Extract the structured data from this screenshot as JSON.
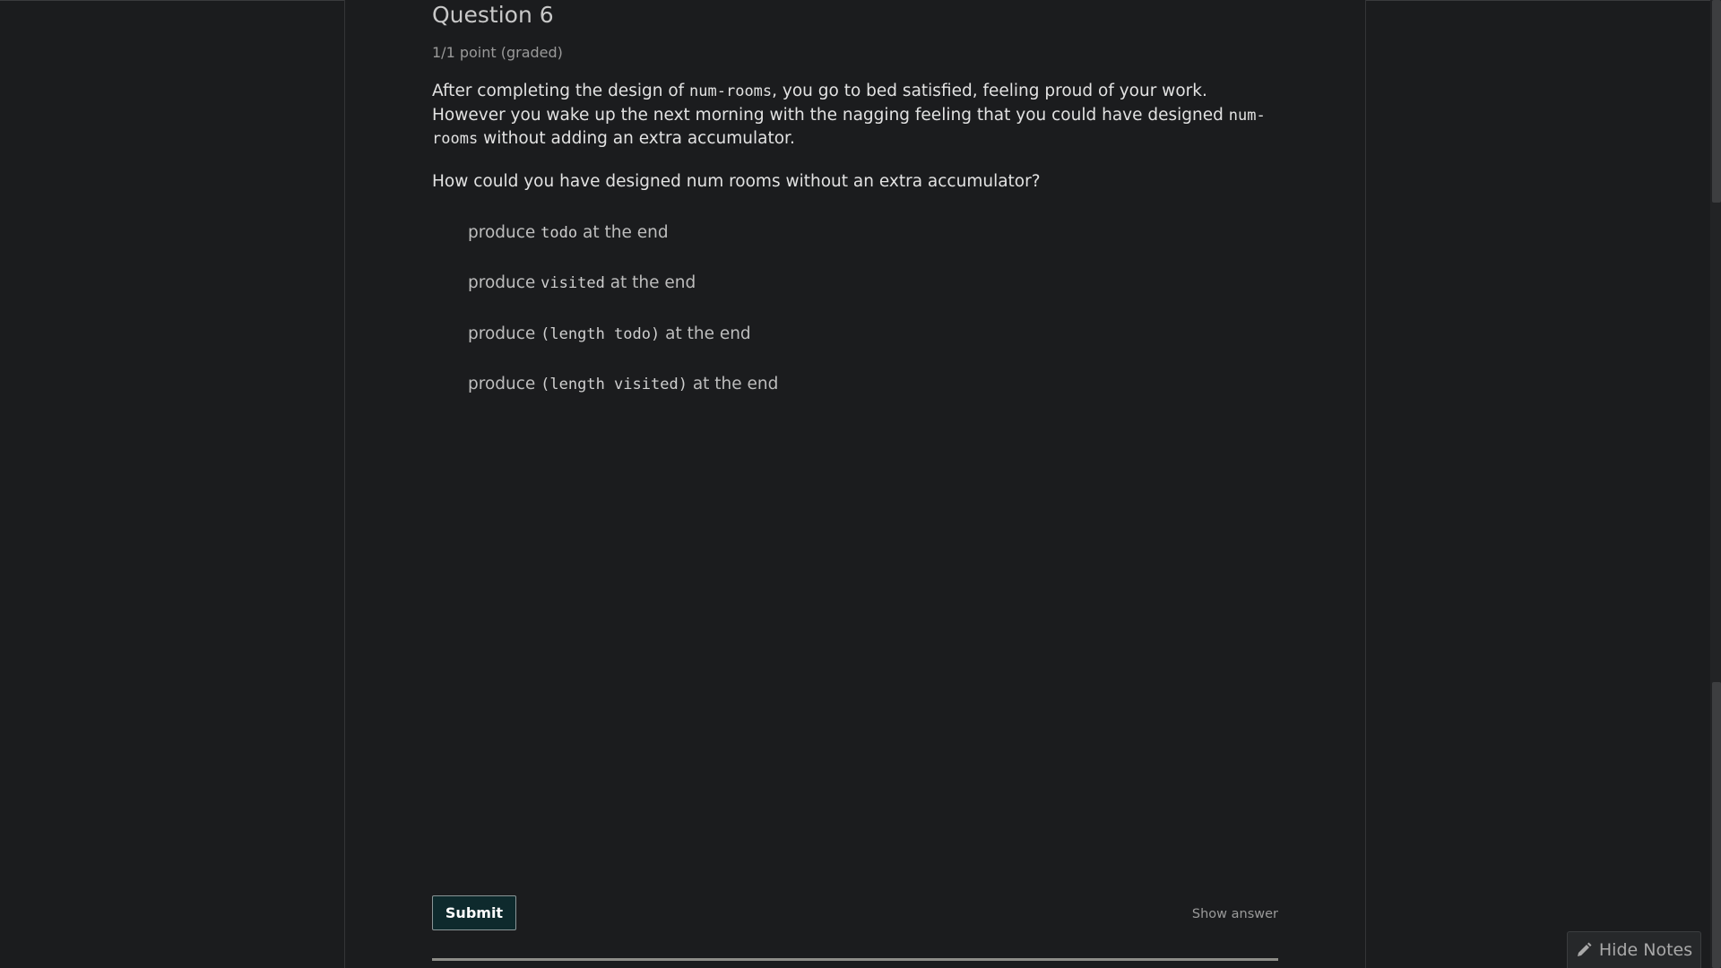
{
  "question": {
    "title": "Question 6",
    "points": "1/1 point (graded)",
    "paragraph": {
      "part1": "After completing the design of ",
      "code1": "num-rooms",
      "part2": ", you go to bed satisfied, feeling proud of your work. However you wake up the next morning with the nagging feeling that you could have designed ",
      "code2": "num-rooms",
      "part3": " without adding an extra accumulator."
    },
    "prompt": "How could you have designed num rooms without an extra accumulator?",
    "choices": [
      {
        "prefix": "produce ",
        "code": "todo",
        "suffix": " at the end"
      },
      {
        "prefix": "produce ",
        "code": "visited",
        "suffix": " at the end"
      },
      {
        "prefix": "produce ",
        "code": "(length todo)",
        "suffix": " at the end"
      },
      {
        "prefix": "produce ",
        "code": "(length visited)",
        "suffix": " at the end"
      }
    ]
  },
  "actions": {
    "submit_label": "Submit",
    "show_answer_label": "Show answer"
  },
  "notes_toggle": {
    "label": "Hide Notes",
    "icon": "pencil-icon"
  }
}
